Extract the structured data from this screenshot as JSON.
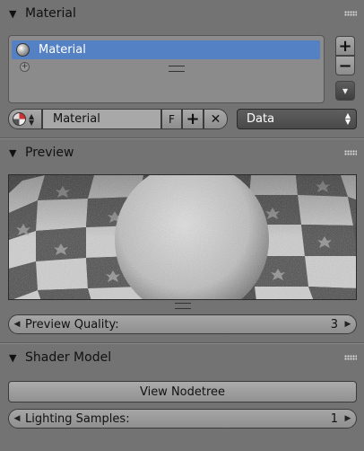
{
  "material_panel": {
    "title": "Material",
    "collapse_state": "expanded",
    "list_items": [
      {
        "label": "Material",
        "selected": true
      }
    ],
    "side_buttons": {
      "add": "+",
      "remove": "−",
      "menu": "▾"
    },
    "datablock": {
      "name": "Material",
      "fake_user": "F",
      "new": "+",
      "unlink": "✕"
    },
    "link_select": "Data"
  },
  "preview_panel": {
    "title": "Preview",
    "quality_label": "Preview Quality:",
    "quality_value": "3"
  },
  "shader_panel": {
    "title": "Shader Model",
    "view_nodetree": "View Nodetree",
    "samples_label": "Lighting Samples:",
    "samples_value": "1"
  },
  "colors": {
    "background": "#737373",
    "selected_row": "#5480c4",
    "dark_select": "#4d4d4d"
  },
  "icons": [
    "triangle-down-icon",
    "drag-grip-icon",
    "material-sphere-icon",
    "add-icon",
    "remove-icon",
    "dropdown-icon",
    "close-icon"
  ]
}
